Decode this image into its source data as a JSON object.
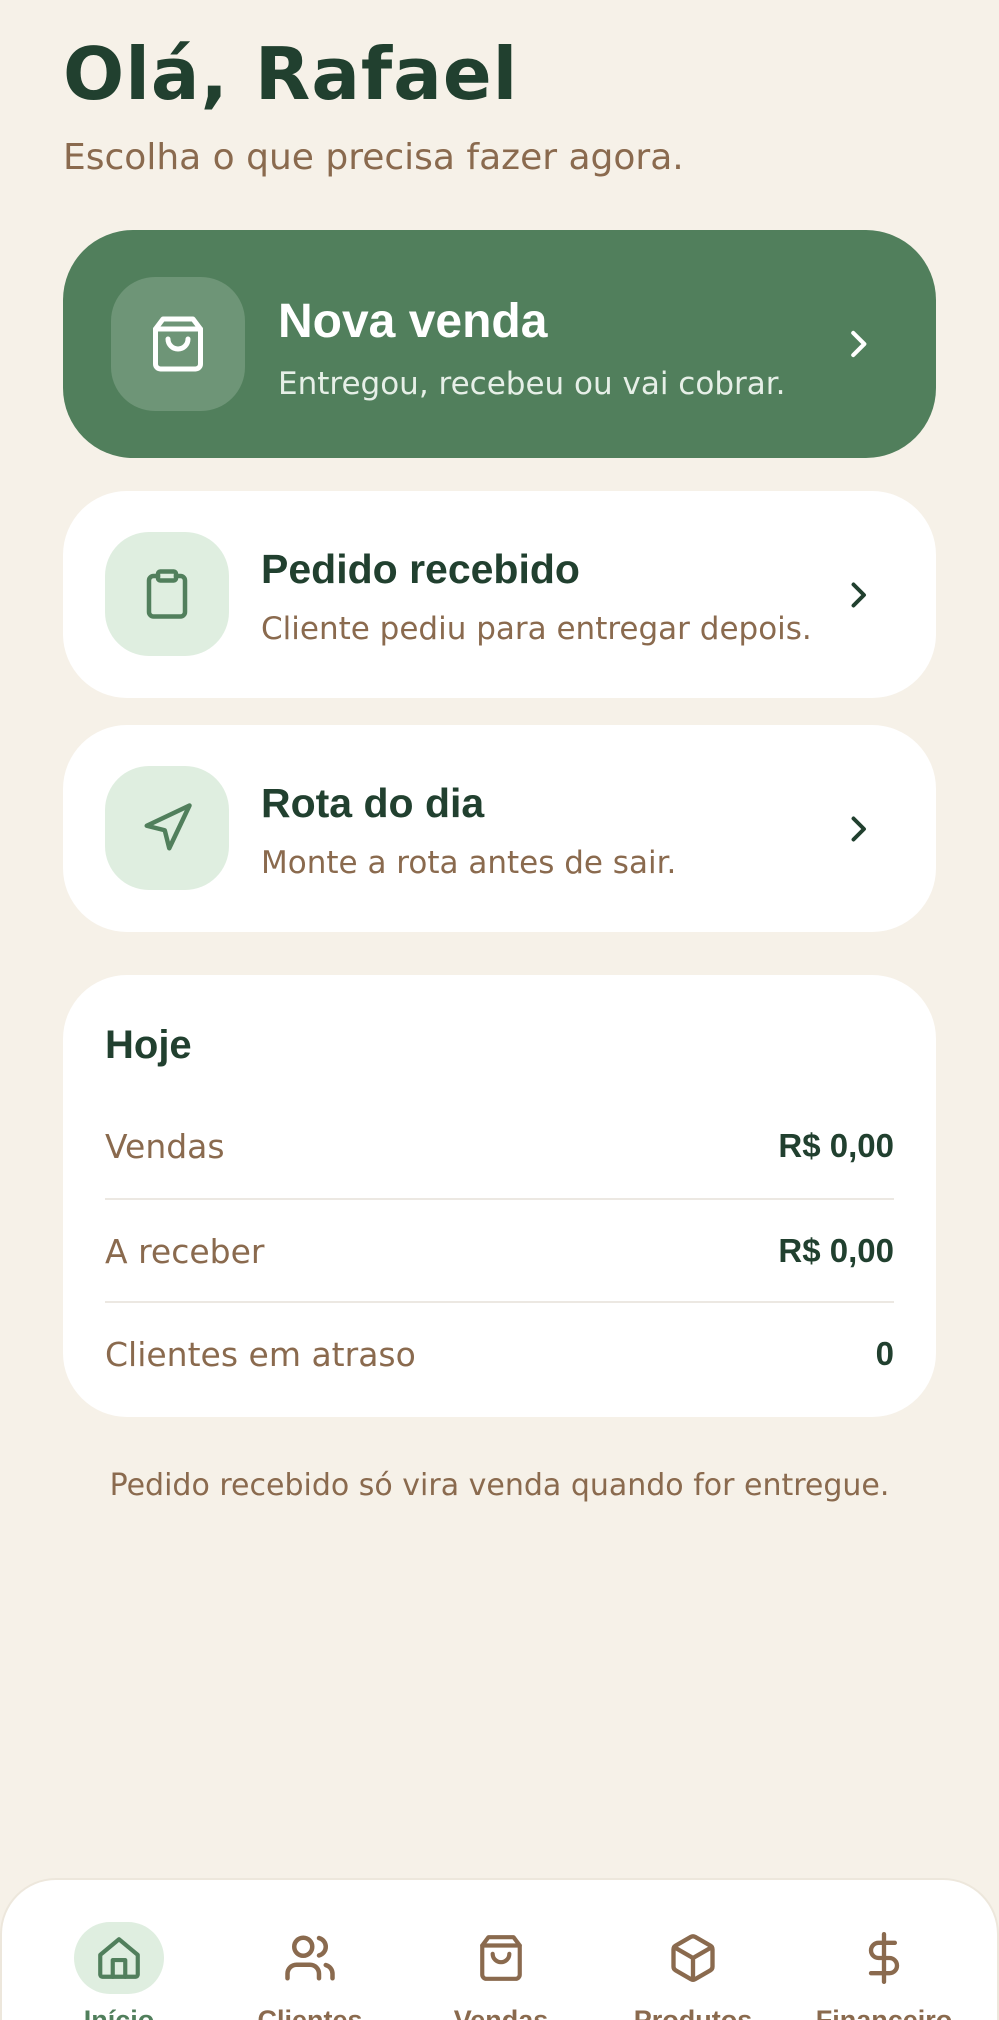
{
  "header": {
    "greeting": "Olá, Rafael",
    "subtitle": "Escolha o que precisa fazer agora."
  },
  "actions": [
    {
      "title": "Nova venda",
      "description": "Entregou, recebeu ou vai cobrar.",
      "icon": "shopping-bag-icon"
    },
    {
      "title": "Pedido recebido",
      "description": "Cliente pediu para entregar depois.",
      "icon": "clipboard-icon"
    },
    {
      "title": "Rota do dia",
      "description": "Monte a rota antes de sair.",
      "icon": "navigation-icon"
    }
  ],
  "today": {
    "title": "Hoje",
    "rows": [
      {
        "label": "Vendas",
        "value": "R$ 0,00"
      },
      {
        "label": "A receber",
        "value": "R$ 0,00"
      },
      {
        "label": "Clientes em atraso",
        "value": "0"
      }
    ]
  },
  "note": "Pedido recebido só vira venda quando for entregue.",
  "nav": {
    "items": [
      {
        "label": "Início",
        "icon": "home-icon",
        "active": true
      },
      {
        "label": "Clientes",
        "icon": "users-icon",
        "active": false
      },
      {
        "label": "Vendas",
        "icon": "shopping-bag-icon",
        "active": false
      },
      {
        "label": "Produtos",
        "icon": "box-icon",
        "active": false
      },
      {
        "label": "Financeiro",
        "icon": "dollar-icon",
        "active": false
      }
    ]
  },
  "colors": {
    "background": "#f6f1e8",
    "primary": "#517f5c",
    "primary_dark": "#21402f",
    "muted_brown": "#8a6a4e",
    "icon_bg_light": "#dfeee0"
  }
}
